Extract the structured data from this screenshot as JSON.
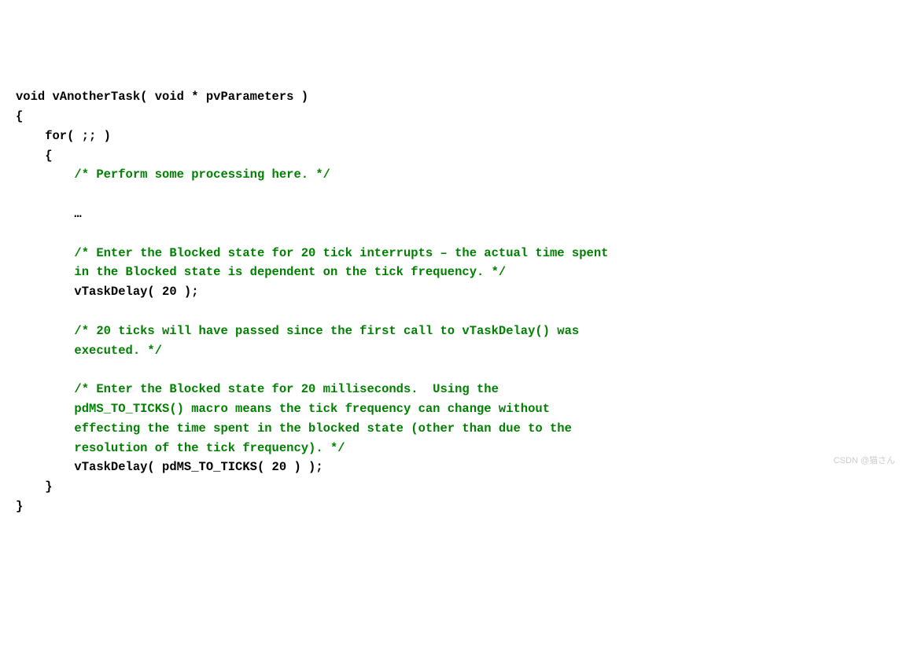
{
  "code": {
    "l01_a": "void vAnotherTask( void * pvParameters )",
    "l02_a": "{",
    "l03_a": "    for( ;; )",
    "l04_a": "    {",
    "l05_c": "        /* Perform some processing here. */",
    "l06_a": "",
    "l07_a": "        …",
    "l08_a": "",
    "l09_c": "        /* Enter the Blocked state for 20 tick interrupts – the actual time spent",
    "l10_c": "        in the Blocked state is dependent on the tick frequency. */",
    "l11_a": "        vTaskDelay( 20 );",
    "l12_a": "",
    "l13_c": "        /* 20 ticks will have passed since the first call to vTaskDelay() was",
    "l14_c": "        executed. */",
    "l15_a": "",
    "l16_c": "        /* Enter the Blocked state for 20 milliseconds.  Using the",
    "l17_c": "        pdMS_TO_TICKS() macro means the tick frequency can change without",
    "l18_c": "        effecting the time spent in the blocked state (other than due to the",
    "l19_c": "        resolution of the tick frequency). */",
    "l20_a": "        vTaskDelay( pdMS_TO_TICKS( 20 ) );",
    "l21_a": "    }",
    "l22_a": "}"
  },
  "watermark": "CSDN @猫さん"
}
